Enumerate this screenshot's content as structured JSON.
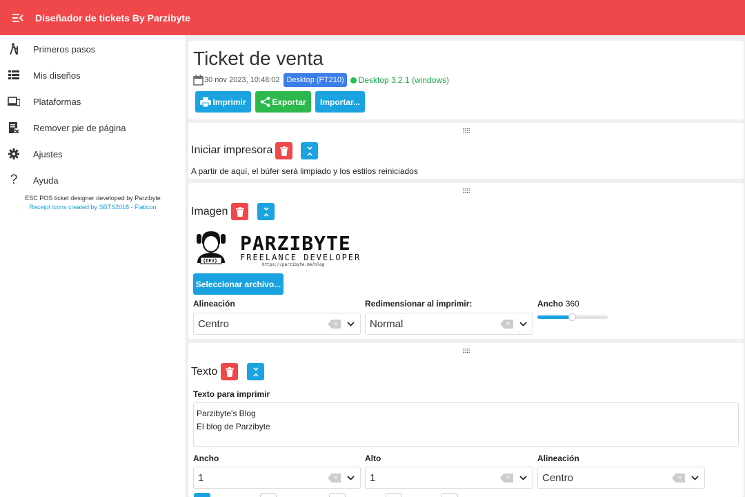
{
  "app": {
    "title": "Diseñador de tickets By Parzibyte"
  },
  "sidebar": {
    "items": [
      {
        "label": "Primeros pasos",
        "icon": "hiking-icon"
      },
      {
        "label": "Mis diseños",
        "icon": "list-icon"
      },
      {
        "label": "Plataformas",
        "icon": "devices-icon"
      },
      {
        "label": "Remover pie de página",
        "icon": "receipt-remove-icon"
      },
      {
        "label": "Ajustes",
        "icon": "gear-icon"
      },
      {
        "label": "Ayuda",
        "icon": "question-icon"
      }
    ],
    "credits_line1": "ESC POS ticket designer developed by Parzibyte",
    "credits_line2": "Receipt icons created by SBTS2018 - Flaticon"
  },
  "header": {
    "title": "Ticket de venta",
    "date": "30 nov 2023, 10:48:02",
    "badge": "Desktop (PT210)",
    "status": "Desktop 3.2.1 (windows)",
    "buttons": {
      "print": "Imprimir",
      "export": "Exportar",
      "import": "Importar..."
    }
  },
  "blocks": {
    "init": {
      "title": "Iniciar impresora",
      "description": "A partir de aquí, el búfer será limpiado y los estilos reiniciados"
    },
    "image": {
      "title": "Imagen",
      "logo_name": "PARZIBYTE",
      "logo_sub": "FREELANCE DEVELOPER",
      "logo_url": "https://parzibyte.me/blog",
      "logo_dev": "{DEV}",
      "select_file": "Seleccionar archivo...",
      "align_label": "Alineación",
      "align_value": "Centro",
      "resize_label": "Redimensionar al imprimir:",
      "resize_value": "Normal",
      "width_label": "Ancho",
      "width_value": "360",
      "width_fraction": 0.5
    },
    "text": {
      "title": "Texto",
      "text_label": "Texto para imprimir",
      "line1": "Parzibyte's Blog",
      "line2": "El blog de Parzibyte",
      "width_label": "Ancho",
      "width_value": "1",
      "height_label": "Alto",
      "height_value": "1",
      "align_label": "Alineación",
      "align_value": "Centro"
    }
  },
  "colors": {
    "accent": "#f0474a",
    "primary": "#1aa3e0",
    "success": "#2cb84c",
    "badge": "#3b7de9"
  }
}
